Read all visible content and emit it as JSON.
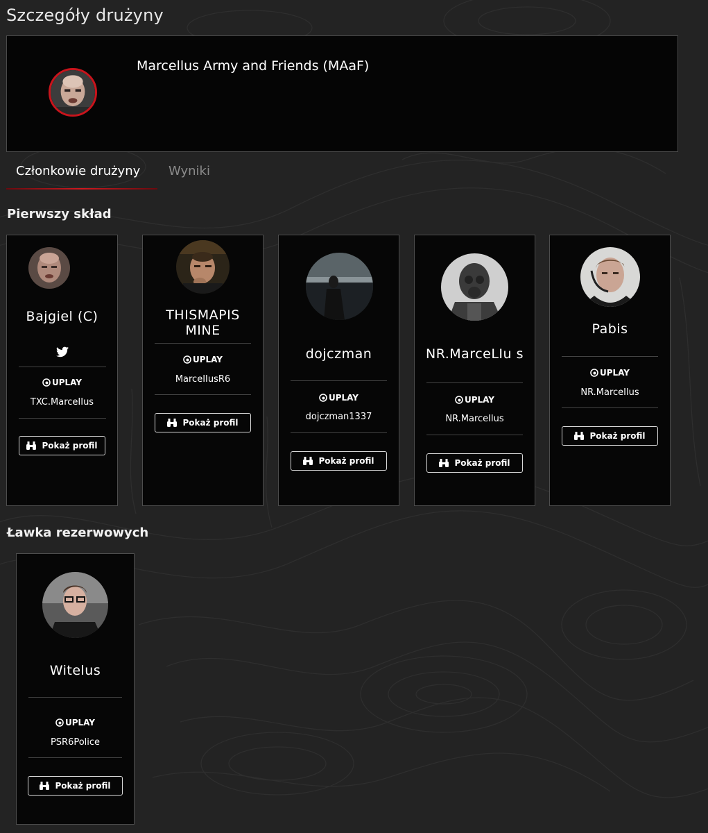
{
  "page": {
    "title": "Szczegóły drużyny"
  },
  "team": {
    "name": "Marcellus Army and Friends (MAaF)"
  },
  "tabs": [
    {
      "label": "Członkowie drużyny",
      "active": true
    },
    {
      "label": "Wyniki",
      "active": false
    }
  ],
  "sections": {
    "main_roster": "Pierwszy skład",
    "bench": "Ławka rezerwowych"
  },
  "platform_label": "UPLAY",
  "profile_button_label": "Pokaż profil",
  "main_roster": [
    {
      "name": "Bajgiel (C)",
      "has_twitter": true,
      "uplay_id": "TXC.MarceIIus"
    },
    {
      "name": "THISMAPIS MINE",
      "uplay_id": "MarceIIusR6"
    },
    {
      "name": "dojczman",
      "uplay_id": "dojczman1337"
    },
    {
      "name": "NR.MarceLIu s",
      "uplay_id": "NR.MarceIlus"
    },
    {
      "name": "Pabis",
      "uplay_id": "NR.MarceIlus"
    }
  ],
  "bench": [
    {
      "name": "Witelus",
      "uplay_id": "PSR6Police"
    }
  ],
  "colors": {
    "accent": "#d0181f",
    "background": "#232323",
    "card": "#060606",
    "border": "#4d4d4d"
  }
}
